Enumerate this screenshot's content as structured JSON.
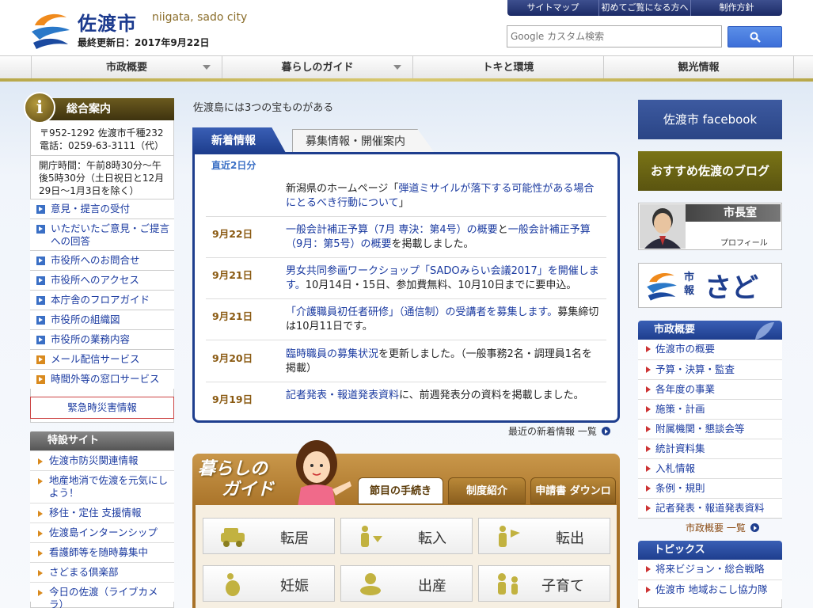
{
  "header": {
    "site_name": "佐渡市",
    "site_name_en": "niigata, sado city",
    "last_updated": "最終更新日：2017年9月22日",
    "top_links": [
      "サイトマップ",
      "初めてご覧になる方へ",
      "制作方針"
    ],
    "search_placeholder": "Google カスタム検索"
  },
  "global_nav": [
    {
      "label": "市政概要",
      "has_dropdown": true
    },
    {
      "label": "暮らしのガイド",
      "has_dropdown": true
    },
    {
      "label": "トキと環境",
      "has_dropdown": false
    },
    {
      "label": "観光情報",
      "has_dropdown": false
    }
  ],
  "left": {
    "info_title": "総合案内",
    "info_icon": "i",
    "address": "〒952-1292 佐渡市千種232",
    "phone": "電話：0259-63-3111（代）",
    "hours": "開庁時間：午前8時30分～午後5時30分（土日祝日と12月29日～1月3日を除く）",
    "links": [
      "意見・提言の受付",
      "いただいたご意見・ご提言への回答",
      "市役所へのお問合せ",
      "市役所へのアクセス",
      "本庁舎のフロアガイド",
      "市役所の組織図",
      "市役所の業務内容",
      "メール配信サービス",
      "時間外等の窓口サービス"
    ],
    "emergency": "緊急時災害情報",
    "special_title": "特設サイト",
    "special_links": [
      "佐渡市防災関連情報",
      "地産地消で佐渡を元気にしよう！",
      "移住・定住 支援情報",
      "佐渡島インターンシップ",
      "看護師等を随時募集中",
      "さどまる倶楽部",
      "今日の佐渡（ライブカメラ）"
    ]
  },
  "center": {
    "tagline": "佐渡島には3つの宝ものがある",
    "tabs": [
      "新着情報",
      "募集情報・開催案内"
    ],
    "recent_label": "直近2日分",
    "news": [
      {
        "date": "",
        "link": "弾道ミサイルが落下する可能性がある場合にとるべき行動について",
        "prefix": "新潟県のホームページ「",
        "suffix": "」"
      },
      {
        "date": "9月22日",
        "link": "一般会計補正予算（7月 専決：第4号）の概要",
        "middle": "と",
        "link2": "一般会計補正予算（9月：第5号）の概要",
        "suffix": "を掲載しました。"
      },
      {
        "date": "9月21日",
        "link": "男女共同参画ワークショップ「SADOみらい会議2017」を開催します。",
        "suffix": "10月14日・15日、参加費無料、10月10日までに要申込。"
      },
      {
        "date": "9月21日",
        "link": "「介護職員初任者研修」（通信制）の受講者を募集します。",
        "suffix": "募集締切は10月11日です。"
      },
      {
        "date": "9月20日",
        "link": "臨時職員の募集状況",
        "suffix": "を更新しました。（一般事務2名・調理員1名を掲載）"
      },
      {
        "date": "9月19日",
        "link": "記者発表・報道発表資料",
        "suffix": "に、前週発表分の資料を掲載しました。"
      }
    ],
    "news_more": "最近の新着情報 一覧",
    "guide_title_1": "暮らしの",
    "guide_title_2": "ガイド",
    "guide_tabs": [
      "節目の手続き",
      "制度紹介",
      "申請書 ダウンロード"
    ],
    "guide_buttons": [
      "転居",
      "転入",
      "転出",
      "妊娠",
      "出産",
      "子育て"
    ]
  },
  "right": {
    "facebook": "佐渡市 facebook",
    "blog": "おすすめ佐渡のブログ",
    "mayor": "市長室",
    "mayor_sub": "プロフィール",
    "koho_label": "市報",
    "koho_name": "さど",
    "sisei_title": "市政概要",
    "sisei_links": [
      "佐渡市の概要",
      "予算・決算・監査",
      "各年度の事業",
      "施策・計画",
      "附属機関・懇談会等",
      "統計資料集",
      "入札情報",
      "条例・規則",
      "記者発表・報道発表資料"
    ],
    "sisei_more": "市政概要 一覧",
    "topics_title": "トピックス",
    "topics_links": [
      "将来ビジョン・総合戦略",
      "佐渡市 地域おこし協力隊"
    ]
  },
  "colors": {
    "navy": "#1e3e8e",
    "gold": "#a87228",
    "olive": "#5a4814"
  }
}
